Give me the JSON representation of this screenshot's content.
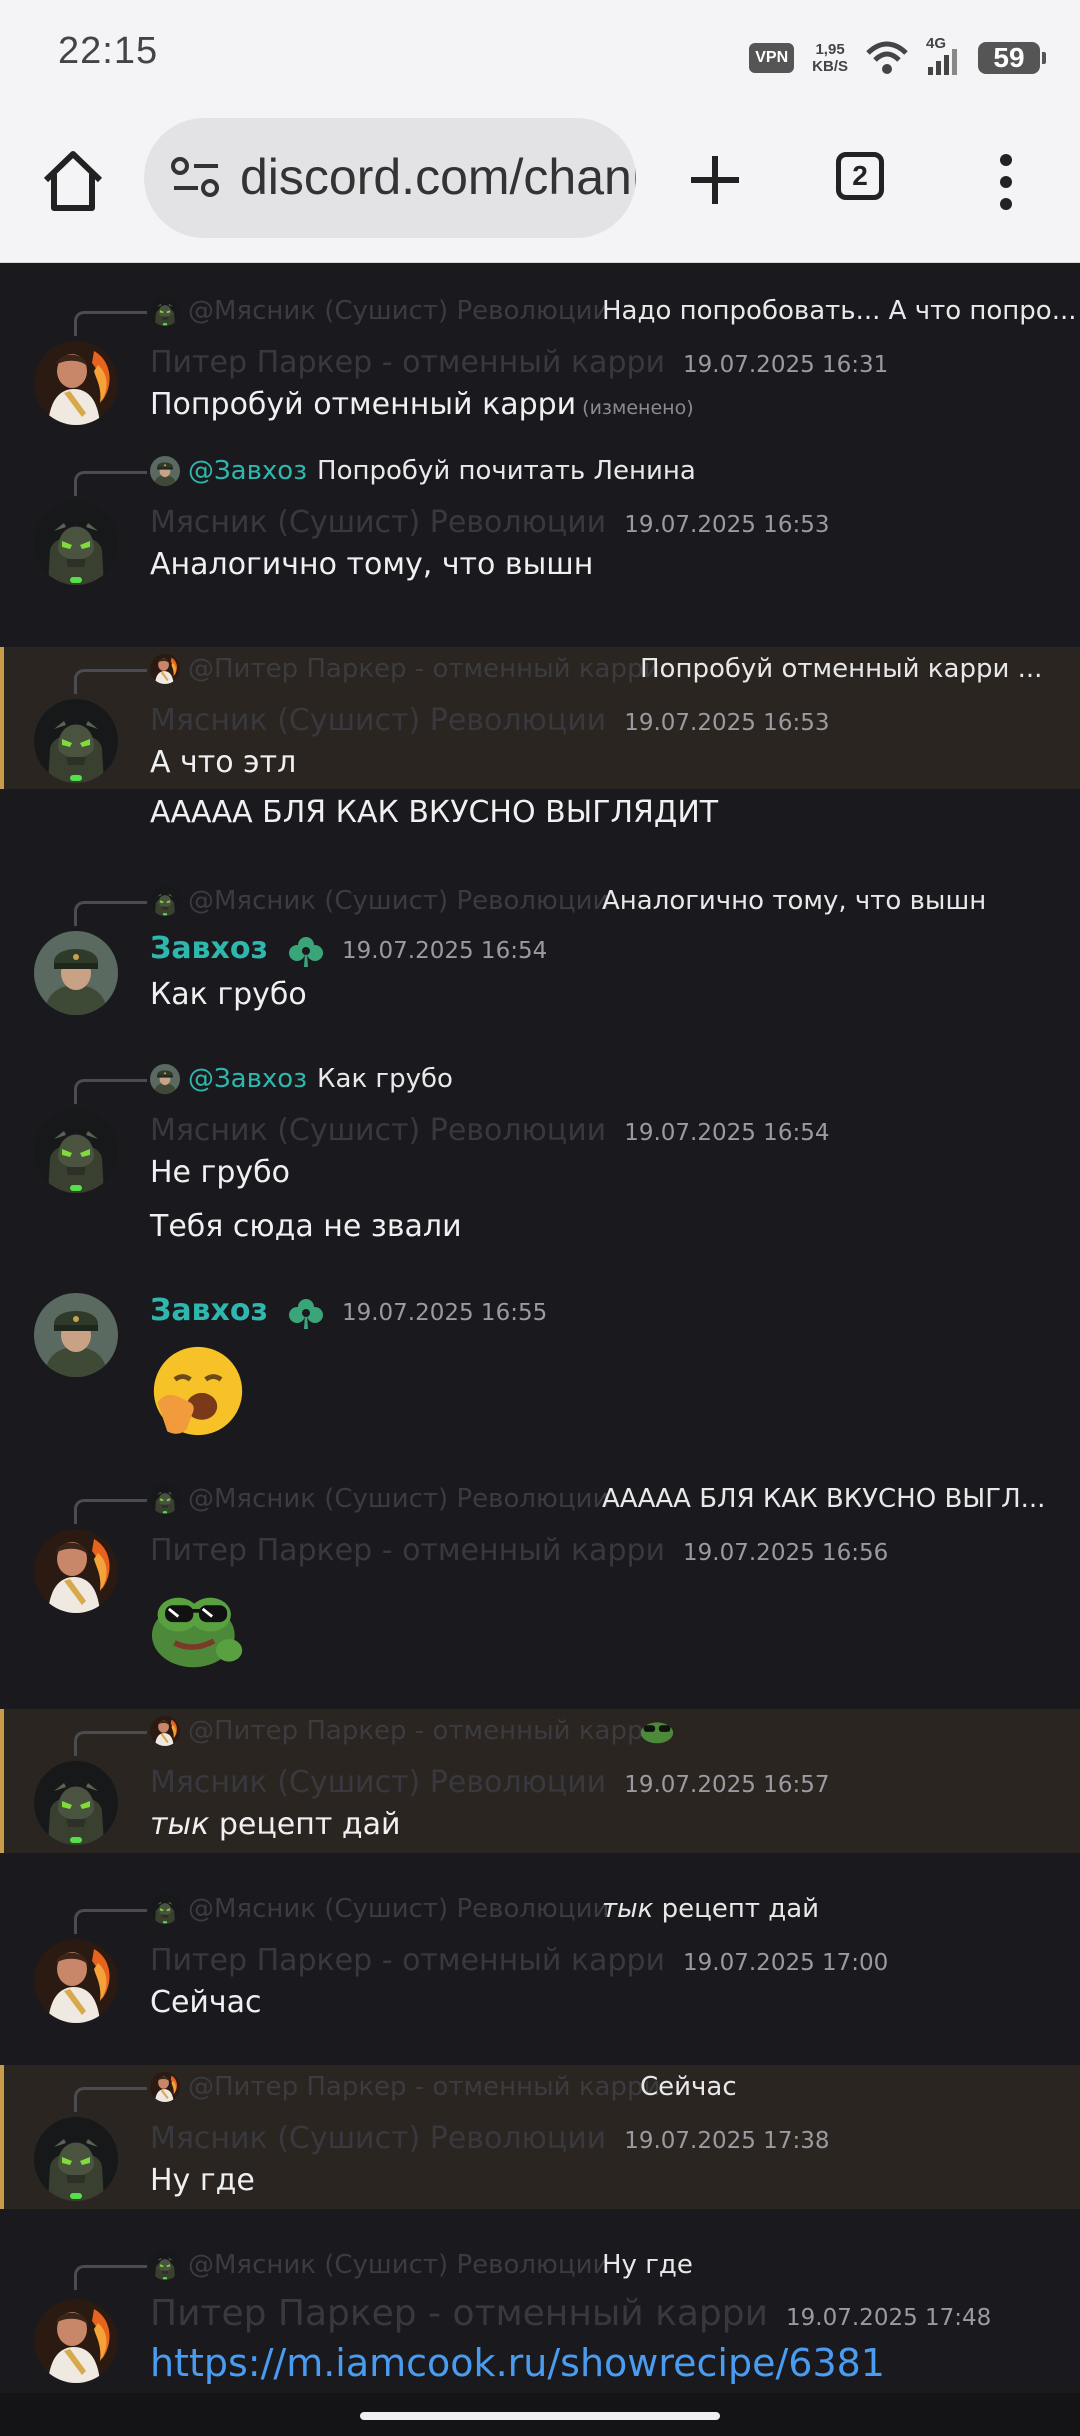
{
  "status_bar": {
    "time": "22:15",
    "vpn": "VPN",
    "speed_value": "1,95",
    "speed_unit": "KB/S",
    "network": "4G",
    "battery": "59"
  },
  "browser": {
    "url": "discord.com/channels",
    "tab_count": "2"
  },
  "colors": {
    "background": "#1a1a1e",
    "highlight": "#2a2520",
    "highlight_bar": "#c79b4a",
    "teal": "#2fb6ad",
    "link": "#4a9cf0",
    "timestamp": "#9a9aa0"
  },
  "messages": [
    {
      "reply_name": "@Мясник (Сушист) Революции",
      "reply_text": "Надо попробовать... А что попро...",
      "author": "Питер Паркер - отменный карри",
      "time": "19.07.2025 16:31",
      "lines": [
        "Попробуй отменный карри"
      ],
      "edited": "(изменено)"
    },
    {
      "reply_name": "@Завхоз",
      "reply_text": "Попробуй почитать Ленина",
      "author": "Мясник (Сушист) Революции",
      "time": "19.07.2025 16:53",
      "lines": [
        "Аналогично тому, что вышн"
      ]
    },
    {
      "reply_name": "@Питер Паркер - отменный карри",
      "reply_text": "Попробуй отменный карри ...",
      "author": "Мясник (Сушист) Революции",
      "time": "19.07.2025 16:53",
      "lines": [
        "А что этл",
        "ААААА БЛЯ КАК ВКУСНО ВЫГЛЯДИТ"
      ]
    },
    {
      "reply_name": "@Мясник (Сушист) Революции",
      "reply_text": "Аналогично тому, что вышн",
      "author": "Завхоз",
      "time": "19.07.2025 16:54",
      "lines": [
        "Как грубо"
      ]
    },
    {
      "reply_name": "@Завхоз",
      "reply_text": "Как грубо",
      "author": "Мясник (Сушист) Революции",
      "time": "19.07.2025 16:54",
      "lines": [
        "Не грубо",
        "Тебя сюда не звали"
      ]
    },
    {
      "author": "Завхоз",
      "time": "19.07.2025 16:55",
      "emoji": "yawning-face"
    },
    {
      "reply_name": "@Мясник (Сушист) Революции",
      "reply_text": "ААААА БЛЯ КАК ВКУСНО ВЫГЛ...",
      "author": "Питер Паркер - отменный карри",
      "time": "19.07.2025 16:56",
      "emoji": "pepe-sunglasses"
    },
    {
      "reply_name": "@Питер Паркер - отменный карри",
      "author": "Мясник (Сушист) Революции",
      "time": "19.07.2025 16:57",
      "italic": "тык",
      "rest": "рецепт дай"
    },
    {
      "reply_name": "@Мясник (Сушист) Революции",
      "reply_italic": "тык",
      "reply_rest": "рецепт дай",
      "author": "Питер Паркер - отменный карри",
      "time": "19.07.2025 17:00",
      "lines": [
        "Сейчас"
      ]
    },
    {
      "reply_name": "@Питер Паркер - отменный карри",
      "reply_text": "Сейчас",
      "author": "Мясник (Сушист) Революции",
      "time": "19.07.2025 17:38",
      "lines": [
        "Ну где"
      ]
    },
    {
      "reply_name": "@Мясник (Сушист) Революции",
      "reply_text": "Ну где",
      "author": "Питер Паркер - отменный карри",
      "time": "19.07.2025 17:48",
      "link": "https://m.iamcook.ru/showrecipe/6381"
    }
  ]
}
